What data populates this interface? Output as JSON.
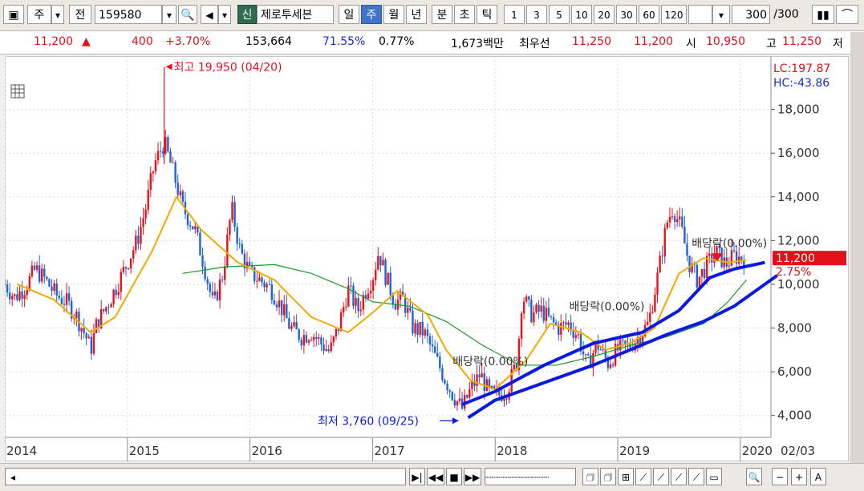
{
  "toolbar": {
    "type_label": "주",
    "name_label": "전",
    "code_value": "159580",
    "sin_label": "신",
    "stock_name": "제로투세븐",
    "period_tabs": [
      "일",
      "주",
      "월",
      "년",
      "분",
      "초",
      "틱"
    ],
    "selected_period": "주",
    "intervals": [
      "1",
      "3",
      "5",
      "10",
      "20",
      "30",
      "60",
      "120"
    ],
    "count_value": "300",
    "count_total": "/300"
  },
  "info": {
    "price": "11,200",
    "change_arrow": "▲",
    "change": "400",
    "change_pct": "+3.70%",
    "volume": "153,664",
    "vol_ratio": "71.55%",
    "turnover": "0.77%",
    "amount": "1,673백만",
    "ask_label": "최우선",
    "ask": "11,250",
    "bid": "11,200",
    "open_label": "시",
    "open": "10,950",
    "high_label": "고",
    "high": "11,250",
    "low_label": "저"
  },
  "chart_data": {
    "type": "candlestick-line",
    "ylim": [
      3000,
      20000
    ],
    "yticks": [
      4000,
      6000,
      8000,
      10000,
      12000,
      14000,
      16000,
      18000
    ],
    "ytick_labels": [
      "4,000",
      "6,000",
      "8,000",
      "10,000",
      "12,000",
      "14,000",
      "16,000",
      "18,000"
    ],
    "xticks": [
      2014,
      2015,
      2016,
      2017,
      2018,
      2019,
      2020
    ],
    "xtick_labels": [
      "2014",
      "2015",
      "2016",
      "2017",
      "2018",
      "2019",
      "2020"
    ],
    "x_end_label": "02/03",
    "xlim": [
      2014.0,
      2020.25
    ],
    "current_price": 11200,
    "current_price_label": "11,200",
    "current_pct_label": "2.75%",
    "lc_label": "LC:197.87",
    "hc_label": "HC:-43.86",
    "high_annotation": "최고 19,950 (04/20)",
    "high_point": {
      "x": 2015.3,
      "y": 19950
    },
    "low_annotation": "최저 3,760 (09/25)",
    "low_point": {
      "x": 2017.73,
      "y": 3760
    },
    "dividend_label": "배당락(0.00%)",
    "dividends": [
      {
        "x": 2017.85,
        "y": 6300
      },
      {
        "x": 2018.8,
        "y": 8800
      },
      {
        "x": 2019.8,
        "y": 11700
      }
    ],
    "price_path": [
      [
        2014.0,
        10000
      ],
      [
        2014.08,
        9400
      ],
      [
        2014.17,
        9900
      ],
      [
        2014.25,
        10700
      ],
      [
        2014.33,
        10200
      ],
      [
        2014.42,
        9500
      ],
      [
        2014.5,
        9200
      ],
      [
        2014.58,
        8600
      ],
      [
        2014.67,
        7500
      ],
      [
        2014.7,
        7000
      ],
      [
        2014.75,
        8200
      ],
      [
        2014.83,
        9000
      ],
      [
        2014.92,
        10000
      ],
      [
        2015.0,
        11000
      ],
      [
        2015.08,
        12000
      ],
      [
        2015.15,
        13500
      ],
      [
        2015.22,
        15500
      ],
      [
        2015.3,
        16500
      ],
      [
        2015.38,
        15000
      ],
      [
        2015.45,
        13500
      ],
      [
        2015.55,
        12500
      ],
      [
        2015.62,
        11000
      ],
      [
        2015.7,
        9000
      ],
      [
        2015.78,
        10500
      ],
      [
        2015.85,
        13500
      ],
      [
        2015.92,
        11500
      ],
      [
        2016.0,
        10500
      ],
      [
        2016.08,
        10200
      ],
      [
        2016.17,
        9800
      ],
      [
        2016.25,
        9000
      ],
      [
        2016.33,
        8000
      ],
      [
        2016.42,
        7600
      ],
      [
        2016.5,
        7800
      ],
      [
        2016.58,
        7300
      ],
      [
        2016.65,
        6900
      ],
      [
        2016.72,
        8000
      ],
      [
        2016.8,
        9800
      ],
      [
        2016.88,
        8800
      ],
      [
        2016.95,
        9800
      ],
      [
        2017.0,
        10300
      ],
      [
        2017.05,
        11500
      ],
      [
        2017.1,
        10500
      ],
      [
        2017.18,
        9200
      ],
      [
        2017.25,
        9300
      ],
      [
        2017.33,
        8000
      ],
      [
        2017.42,
        7800
      ],
      [
        2017.5,
        6800
      ],
      [
        2017.58,
        5800
      ],
      [
        2017.65,
        5000
      ],
      [
        2017.73,
        4300
      ],
      [
        2017.8,
        5200
      ],
      [
        2017.88,
        5900
      ],
      [
        2017.95,
        5000
      ],
      [
        2018.02,
        4900
      ],
      [
        2018.1,
        5200
      ],
      [
        2018.18,
        6500
      ],
      [
        2018.22,
        9500
      ],
      [
        2018.3,
        8600
      ],
      [
        2018.38,
        8800
      ],
      [
        2018.45,
        8300
      ],
      [
        2018.52,
        8000
      ],
      [
        2018.6,
        8200
      ],
      [
        2018.68,
        7600
      ],
      [
        2018.75,
        6200
      ],
      [
        2018.83,
        7300
      ],
      [
        2018.92,
        6400
      ],
      [
        2019.0,
        7000
      ],
      [
        2019.08,
        7100
      ],
      [
        2019.17,
        7600
      ],
      [
        2019.25,
        8200
      ],
      [
        2019.33,
        10500
      ],
      [
        2019.4,
        12800
      ],
      [
        2019.45,
        13500
      ],
      [
        2019.52,
        12500
      ],
      [
        2019.58,
        11000
      ],
      [
        2019.65,
        10200
      ],
      [
        2019.72,
        10800
      ],
      [
        2019.8,
        11500
      ],
      [
        2019.88,
        10900
      ],
      [
        2019.95,
        11300
      ],
      [
        2020.0,
        11200
      ],
      [
        2020.05,
        11200
      ]
    ],
    "ma_short": [
      [
        2014.1,
        10000
      ],
      [
        2014.4,
        9300
      ],
      [
        2014.7,
        7800
      ],
      [
        2014.9,
        8500
      ],
      [
        2015.2,
        11500
      ],
      [
        2015.4,
        14000
      ],
      [
        2015.6,
        12500
      ],
      [
        2015.9,
        11000
      ],
      [
        2016.2,
        10200
      ],
      [
        2016.5,
        8500
      ],
      [
        2016.8,
        7800
      ],
      [
        2017.0,
        8700
      ],
      [
        2017.2,
        9700
      ],
      [
        2017.45,
        8600
      ],
      [
        2017.6,
        7000
      ],
      [
        2017.8,
        5600
      ],
      [
        2018.0,
        5200
      ],
      [
        2018.25,
        6500
      ],
      [
        2018.45,
        8200
      ],
      [
        2018.7,
        7800
      ],
      [
        2018.9,
        7000
      ],
      [
        2019.1,
        7300
      ],
      [
        2019.3,
        8000
      ],
      [
        2019.5,
        10500
      ],
      [
        2019.7,
        11200
      ],
      [
        2019.9,
        11000
      ],
      [
        2020.05,
        11100
      ]
    ],
    "ma_long": [
      [
        2015.45,
        10500
      ],
      [
        2015.8,
        10800
      ],
      [
        2016.2,
        10900
      ],
      [
        2016.5,
        10500
      ],
      [
        2016.8,
        9800
      ],
      [
        2017.0,
        9200
      ],
      [
        2017.3,
        9000
      ],
      [
        2017.6,
        8300
      ],
      [
        2017.9,
        7200
      ],
      [
        2018.2,
        6300
      ],
      [
        2018.5,
        6300
      ],
      [
        2018.8,
        6700
      ],
      [
        2019.1,
        7200
      ],
      [
        2019.4,
        7600
      ],
      [
        2019.7,
        8200
      ],
      [
        2019.9,
        9200
      ],
      [
        2020.05,
        10200
      ]
    ],
    "trend_upper": [
      [
        2017.73,
        4500
      ],
      [
        2018.0,
        5100
      ],
      [
        2018.4,
        6300
      ],
      [
        2018.8,
        7300
      ],
      [
        2019.2,
        7800
      ],
      [
        2019.5,
        8800
      ],
      [
        2019.75,
        10300
      ],
      [
        2019.95,
        10700
      ],
      [
        2020.2,
        11000
      ]
    ],
    "trend_lower": [
      [
        2017.78,
        3900
      ],
      [
        2018.0,
        4700
      ],
      [
        2018.4,
        5500
      ],
      [
        2018.8,
        6300
      ],
      [
        2019.1,
        7000
      ],
      [
        2019.4,
        7700
      ],
      [
        2019.7,
        8300
      ],
      [
        2019.95,
        9000
      ],
      [
        2020.3,
        10400
      ]
    ],
    "colors": {
      "up": "#e8121c",
      "down": "#1f63d6",
      "ma_short": "#f2a900",
      "ma_long": "#1a9a2a",
      "trend": "#0a1ae0"
    }
  },
  "bottombar": {
    "buttons": [
      "▶|",
      "◀◀",
      "■",
      "▶▶"
    ],
    "tools": [
      "🗇",
      "🗇",
      "⊞",
      "⟋",
      "⟋",
      "⟋",
      "⟋",
      "▭",
      "🔍",
      "−",
      "+",
      "A"
    ]
  }
}
